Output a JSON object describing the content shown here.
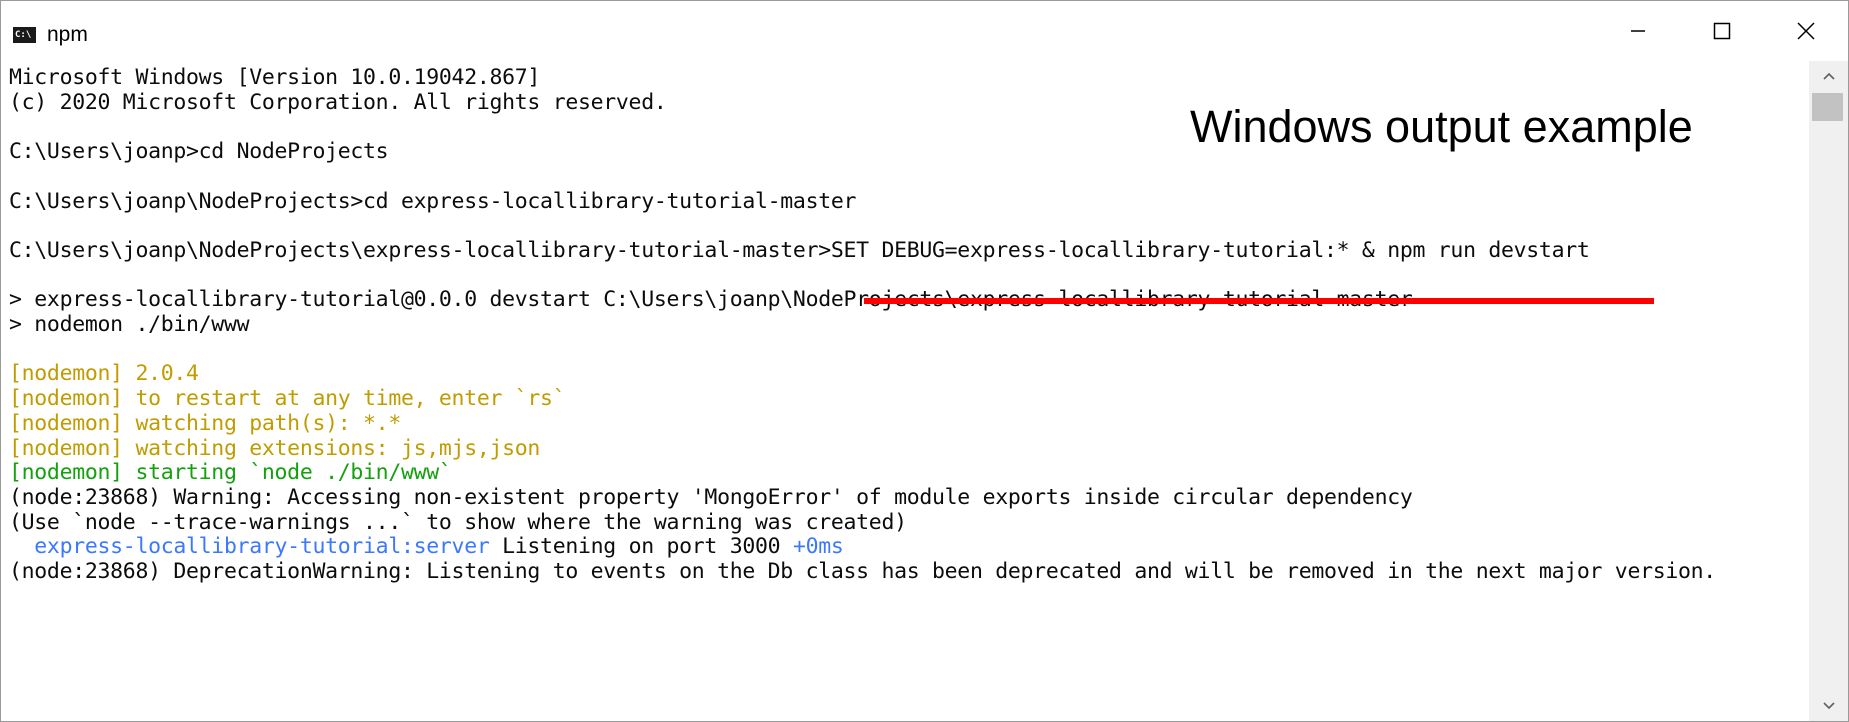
{
  "window": {
    "title": "npm",
    "icon": "console-icon"
  },
  "annotation": "Windows output example",
  "lines": [
    {
      "segments": [
        {
          "text": "Microsoft Windows [Version 10.0.19042.867]",
          "color": "default"
        }
      ]
    },
    {
      "segments": [
        {
          "text": "(c) 2020 Microsoft Corporation. All rights reserved.",
          "color": "default"
        }
      ]
    },
    {
      "segments": [
        {
          "text": "",
          "color": "default"
        }
      ]
    },
    {
      "segments": [
        {
          "text": "C:\\Users\\joanp>cd NodeProjects",
          "color": "default"
        }
      ]
    },
    {
      "segments": [
        {
          "text": "",
          "color": "default"
        }
      ]
    },
    {
      "segments": [
        {
          "text": "C:\\Users\\joanp\\NodeProjects>cd express-locallibrary-tutorial-master",
          "color": "default"
        }
      ]
    },
    {
      "segments": [
        {
          "text": "",
          "color": "default"
        }
      ]
    },
    {
      "segments": [
        {
          "text": "C:\\Users\\joanp\\NodeProjects\\express-locallibrary-tutorial-master>SET DEBUG=express-locallibrary-tutorial:* & npm run devstart",
          "color": "default"
        }
      ]
    },
    {
      "segments": [
        {
          "text": "",
          "color": "default"
        }
      ]
    },
    {
      "segments": [
        {
          "text": "> express-locallibrary-tutorial@0.0.0 devstart C:\\Users\\joanp\\NodeProjects\\express-locallibrary-tutorial-master",
          "color": "default"
        }
      ]
    },
    {
      "segments": [
        {
          "text": "> nodemon ./bin/www",
          "color": "default"
        }
      ]
    },
    {
      "segments": [
        {
          "text": "",
          "color": "default"
        }
      ]
    },
    {
      "segments": [
        {
          "text": "[nodemon] 2.0.4",
          "color": "yellow"
        }
      ]
    },
    {
      "segments": [
        {
          "text": "[nodemon] to restart at any time, enter `rs`",
          "color": "yellow"
        }
      ]
    },
    {
      "segments": [
        {
          "text": "[nodemon] watching path(s): *.*",
          "color": "yellow"
        }
      ]
    },
    {
      "segments": [
        {
          "text": "[nodemon] watching extensions: js,mjs,json",
          "color": "yellow"
        }
      ]
    },
    {
      "segments": [
        {
          "text": "[nodemon] starting `node ./bin/www`",
          "color": "green"
        }
      ]
    },
    {
      "segments": [
        {
          "text": "(node:23868) Warning: Accessing non-existent property 'MongoError' of module exports inside circular dependency",
          "color": "default"
        }
      ]
    },
    {
      "segments": [
        {
          "text": "(Use `node --trace-warnings ...` to show where the warning was created)",
          "color": "default"
        }
      ]
    },
    {
      "segments": [
        {
          "text": "  express-locallibrary-tutorial:server",
          "color": "blue"
        },
        {
          "text": " Listening on port 3000 ",
          "color": "default"
        },
        {
          "text": "+0ms",
          "color": "blue"
        }
      ]
    },
    {
      "segments": [
        {
          "text": "(node:23868) DeprecationWarning: Listening to events on the Db class has been deprecated and will be removed in the next major version.",
          "color": "default"
        }
      ]
    }
  ],
  "colors": {
    "yellow": "#c19c00",
    "green": "#13a10e",
    "blue": "#3b78ff",
    "underline": "#ff0000"
  }
}
